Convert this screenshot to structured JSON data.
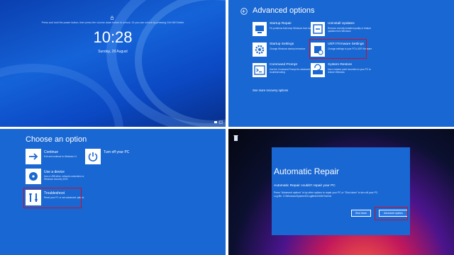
{
  "lock_screen": {
    "message": "Press and hold the power button, then press the volume down button to unlock. Or you can unlock by pressing Ctrl+Alt+Delete",
    "time": "10:28",
    "date": "Sunday, 28 August"
  },
  "advanced_options": {
    "title": "Advanced options",
    "options": [
      {
        "title": "Startup Repair",
        "desc": "Fix problems that keep Windows from loading",
        "icon": "startup-repair-icon"
      },
      {
        "title": "Uninstall Updates",
        "desc": "Remove recently installed quality or feature updates from Windows",
        "icon": "uninstall-updates-icon"
      },
      {
        "title": "Startup Settings",
        "desc": "Change Windows startup behaviour",
        "icon": "gear-icon"
      },
      {
        "title": "UEFI Firmware Settings",
        "desc": "Change settings in your PC's UEFI firmware",
        "icon": "uefi-chip-icon"
      },
      {
        "title": "Command Prompt",
        "desc": "Use the Command Prompt for advanced troubleshooting",
        "icon": "command-prompt-icon"
      },
      {
        "title": "System Restore",
        "desc": "Use a restore point recorded on your PC to restore Windows",
        "icon": "system-restore-icon"
      }
    ],
    "more_link": "See more recovery options"
  },
  "choose_option": {
    "title": "Choose an option",
    "options": [
      {
        "label": "Continue",
        "desc": "Exit and continue to Windows 11",
        "icon": "arrow-right-icon"
      },
      {
        "label": "Turn off your PC",
        "desc": "",
        "icon": "power-icon"
      },
      {
        "label": "Use a device",
        "desc": "Use a USB drive, network connection or Windows recovery DVD",
        "icon": "disc-icon"
      },
      {
        "label": "Troubleshoot",
        "desc": "Reset your PC or see advanced options",
        "icon": "tools-icon"
      }
    ]
  },
  "automatic_repair": {
    "title": "Automatic Repair",
    "subtitle": "Automatic Repair couldn't repair your PC",
    "text": "Press \"Advanced options\" to try other options to repair your PC or \"Shut down\" to turn off your PC.",
    "log": "Log file: C:\\Windows\\System32\\Logfiles\\Srt\\SrtTrail.txt",
    "shutdown_label": "Shut down",
    "advanced_label": "Advanced options"
  },
  "colors": {
    "panel_blue": "#1967d2",
    "highlight_red": "#c8102e"
  }
}
